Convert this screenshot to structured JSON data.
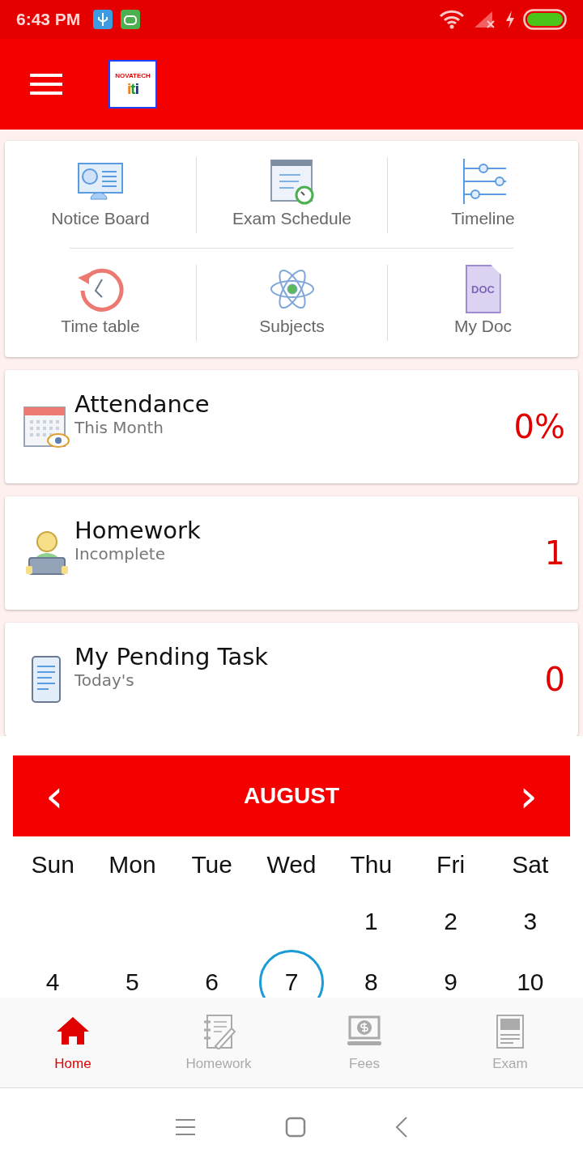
{
  "status_bar": {
    "time": "6:43 PM"
  },
  "app_bar": {
    "logo": {
      "name": "NOVATECH",
      "mark": "iti"
    }
  },
  "menu": [
    {
      "kind": "notice",
      "label": "Notice Board"
    },
    {
      "kind": "exam",
      "label": "Exam Schedule"
    },
    {
      "kind": "timeline",
      "label": "Timeline"
    },
    {
      "kind": "timetable",
      "label": "Time table"
    },
    {
      "kind": "subjects",
      "label": "Subjects"
    },
    {
      "kind": "doc",
      "label": "My Doc",
      "icon_text": "DOC"
    }
  ],
  "cards": [
    {
      "kind": "attendance",
      "title": "Attendance",
      "subtitle": "This Month",
      "value": "0%"
    },
    {
      "kind": "homework",
      "title": "Homework",
      "subtitle": "Incomplete",
      "value": "1"
    },
    {
      "kind": "task",
      "title": "My Pending Task",
      "subtitle": "Today's",
      "value": "0"
    }
  ],
  "calendar": {
    "prev": "‹",
    "month": "AUGUST",
    "next": "›",
    "weekdays": [
      "Sun",
      "Mon",
      "Tue",
      "Wed",
      "Thu",
      "Fri",
      "Sat"
    ],
    "weeks": [
      {
        "days": [
          {
            "kind": "blank"
          },
          {
            "kind": "blank"
          },
          {
            "kind": "blank"
          },
          {
            "kind": "blank"
          },
          {
            "kind": "day",
            "label": "1",
            "selected": false
          },
          {
            "kind": "day",
            "label": "2",
            "selected": false
          },
          {
            "kind": "day",
            "label": "3",
            "selected": false
          }
        ]
      },
      {
        "days": [
          {
            "kind": "day",
            "label": "4",
            "selected": false
          },
          {
            "kind": "day",
            "label": "5",
            "selected": false
          },
          {
            "kind": "day",
            "label": "6",
            "selected": false
          },
          {
            "kind": "day",
            "label": "7",
            "selected": true
          },
          {
            "kind": "day",
            "label": "8",
            "selected": false
          },
          {
            "kind": "day",
            "label": "9",
            "selected": false
          },
          {
            "kind": "day",
            "label": "10",
            "selected": false
          }
        ]
      }
    ]
  },
  "bottom_nav": [
    {
      "kind": "home",
      "label": "Home",
      "selected": true
    },
    {
      "kind": "homework",
      "label": "Homework",
      "selected": false
    },
    {
      "kind": "fees",
      "label": "Fees",
      "selected": false
    },
    {
      "kind": "exam",
      "label": "Exam",
      "selected": false
    }
  ]
}
